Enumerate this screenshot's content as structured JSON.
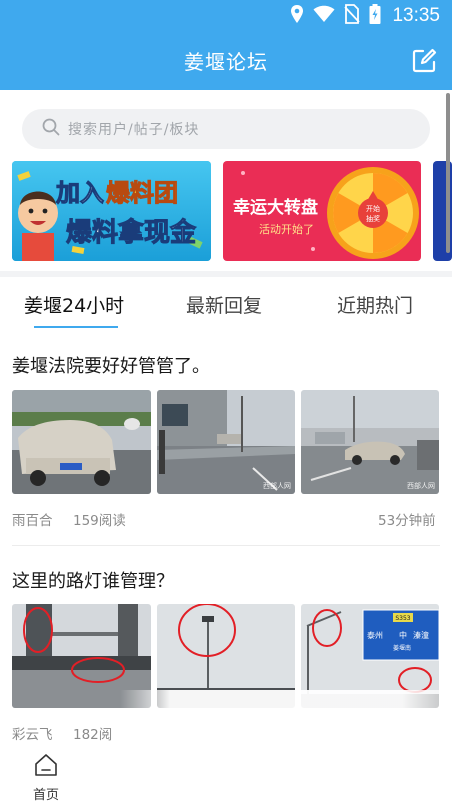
{
  "status_bar": {
    "time": "13:35"
  },
  "app_bar": {
    "title": "姜堰论坛"
  },
  "search": {
    "placeholder": "搜索用户/帖子/板块"
  },
  "banners": [
    {
      "line1_a": "加入",
      "line1_b": "爆料团",
      "line2": "爆料拿现金"
    },
    {
      "title": "幸运大转盘",
      "subtitle": "活动开始了",
      "wheel_center": "开始\n抽奖"
    }
  ],
  "tabs": [
    {
      "label": "姜堰24小时",
      "active": true
    },
    {
      "label": "最新回复",
      "active": false
    },
    {
      "label": "近期热门",
      "active": false
    }
  ],
  "posts": [
    {
      "title": "姜堰法院要好好管管了。",
      "author": "雨百合",
      "reads": "159阅读",
      "time": "53分钟前",
      "watermarks": [
        "",
        "西部人网",
        "西部人网"
      ]
    },
    {
      "title": "这里的路灯谁管理？",
      "author": "彩云飞",
      "reads": "182阅",
      "time": "",
      "sign": {
        "top": "S353",
        "left": "泰州",
        "center": "中",
        "right": "溱潼",
        "sub": "姜堰南"
      }
    }
  ],
  "bottom_nav": [
    {
      "label": "首页",
      "icon": "home-icon"
    }
  ],
  "colors": {
    "primary": "#3fa9ee",
    "banner1_bg": "#2fb6e6",
    "banner2_bg": "#ea2d55"
  }
}
